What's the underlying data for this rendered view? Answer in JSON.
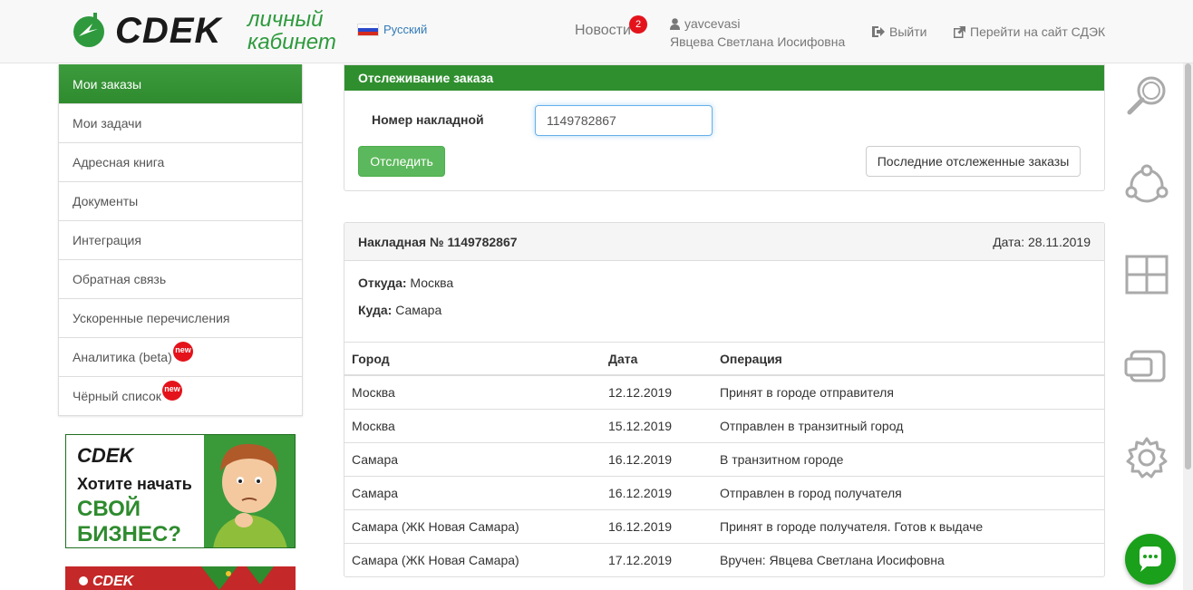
{
  "header": {
    "logo_text": "CDEK",
    "cabinet_label_1": "личный",
    "cabinet_label_2": "кабинет",
    "language": "Русский",
    "news_label": "Новости",
    "news_count": "2",
    "user_login": "yavcevasi",
    "user_name": "Явцева Светлана Иосифовна",
    "logout_label": "Выйти",
    "goto_site_label": "Перейти на сайт СДЭК"
  },
  "sidebar": {
    "items": [
      {
        "label": "Мои заказы"
      },
      {
        "label": "Мои задачи"
      },
      {
        "label": "Адресная книга"
      },
      {
        "label": "Документы"
      },
      {
        "label": "Интеграция"
      },
      {
        "label": "Обратная связь"
      },
      {
        "label": "Ускоренные перечисления"
      },
      {
        "label": "Аналитика (beta)",
        "badge": "new"
      },
      {
        "label": "Чёрный список",
        "badge": "new"
      }
    ]
  },
  "banner": {
    "brand": "CDEK",
    "line1": "Хотите начать",
    "line2": "СВОЙ",
    "line3": "БИЗНЕС?"
  },
  "tracking": {
    "title": "Отслеживание заказа",
    "waybill_label": "Номер накладной",
    "waybill_value": "1149782867",
    "track_button": "Отследить",
    "recent_button": "Последние отслеженные заказы"
  },
  "result": {
    "title": "Накладная № 1149782867",
    "date": "Дата: 28.11.2019",
    "from_label": "Откуда:",
    "from_value": "Москва",
    "to_label": "Куда:",
    "to_value": "Самара",
    "columns": [
      "Город",
      "Дата",
      "Операция"
    ],
    "rows": [
      [
        "Москва",
        "12.12.2019",
        "Принят в городе отправителя"
      ],
      [
        "Москва",
        "15.12.2019",
        "Отправлен в транзитный город"
      ],
      [
        "Самара",
        "16.12.2019",
        "В транзитном городе"
      ],
      [
        "Самара",
        "16.12.2019",
        "Отправлен в город получателя"
      ],
      [
        "Самара (ЖК Новая Самара)",
        "16.12.2019",
        "Принят в городе получателя. Готов к выдаче"
      ],
      [
        "Самара (ЖК Новая Самара)",
        "17.12.2019",
        "Вручен: Явцева Светлана Иосифовна"
      ]
    ]
  },
  "colors": {
    "brand_green": "#2f8f2f",
    "button_green": "#5cb85c",
    "badge_red": "#e4131b"
  }
}
